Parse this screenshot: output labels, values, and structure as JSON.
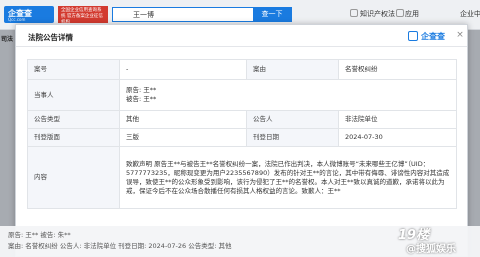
{
  "header": {
    "logo_text": "企查查",
    "logo_sub": "Qcc.com",
    "tagline": "全国企业信用查询系统 官方备案企业征信机构",
    "search_value": "王一博",
    "search_button": "查一下",
    "nav": [
      "知识产权法",
      "应用",
      "企业中"
    ]
  },
  "background": {
    "left_tag": "司法",
    "row1": "原告: 王**      被告: 朱**",
    "row2": "案由: 名誉权纠纷      公告人: 非法院单位      刊登日期: 2024-07-26      公告类型: 其他"
  },
  "modal": {
    "title": "法院公告详情",
    "brand": "企查查",
    "close": "×",
    "rows": {
      "case_no_label": "案号",
      "case_no_value": "-",
      "cause_label": "案由",
      "cause_value": "名誉权纠纷",
      "party_label": "当事人",
      "plaintiff": "原告: 王**",
      "defendant": "被告: 王**",
      "notice_type_label": "公告类型",
      "notice_type_value": "其他",
      "announcer_label": "公告人",
      "announcer_value": "非法院单位",
      "page_label": "刊登版面",
      "page_value": "三版",
      "date_label": "刊登日期",
      "date_value": "2024-07-30",
      "content_label": "内容",
      "content_value": "致歉声明 原告王**与被告王**名誉权纠纷一案，法院已作出判决，本人微博账号“未来哪些王亿博”（UID：5777773235，昵称现变更为用户2235567890）发布的针对王**的言论，其中带有侮辱、诽谤性内容对其造成误导，致使王**的公众形象受到影响，该行为侵犯了王**的名誉权。本人对王**致以真诚的道歉，承诺将以此为戒，保证今后不在公众场合散播任何有损其人格权益的言论。致歉人：王**"
    }
  },
  "watermark": {
    "logo": "19楼",
    "text": "@搜狐娱乐"
  }
}
